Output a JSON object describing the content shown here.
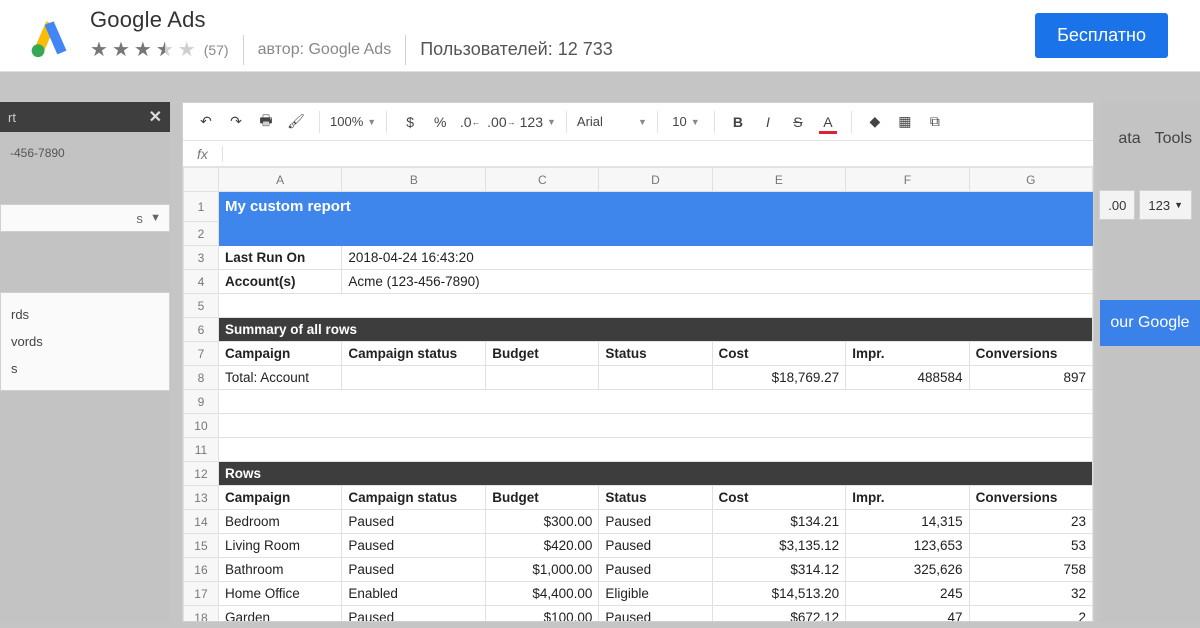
{
  "store": {
    "title": "Google Ads",
    "stars": 3.5,
    "rating_count": "(57)",
    "author_label": "автор: Google Ads",
    "users_label": "Пользователей: 12 733",
    "cta": "Бесплатно"
  },
  "bg_left": {
    "bar_text": "rt",
    "phone": "-456-7890",
    "options": [
      "rds",
      "vords",
      "s"
    ]
  },
  "bg_right": {
    "menu": [
      "ata",
      "Tools"
    ],
    "tb_items": [
      ".00",
      "123"
    ],
    "blue_button": "our Google"
  },
  "toolbar": {
    "zoom": "100%",
    "num_fmt_items": [
      "$",
      "%",
      ".0",
      ".00",
      "123"
    ],
    "font_family": "Arial",
    "font_size": "10"
  },
  "fx": {
    "label": "fx",
    "value": ""
  },
  "columns": [
    "A",
    "B",
    "C",
    "D",
    "E",
    "F",
    "G"
  ],
  "sheet": {
    "report_title": "My custom report",
    "meta": {
      "last_run_label": "Last Run On",
      "last_run_value": "2018-04-24 16:43:20",
      "accounts_label": "Account(s)",
      "accounts_value": "Acme (123-456-7890)"
    },
    "summary_section": "Summary of all rows",
    "rows_section": "Rows",
    "headers": [
      "Campaign",
      "Campaign status",
      "Budget",
      "Status",
      "Cost",
      "Impr.",
      "Conversions"
    ],
    "summary_row": {
      "campaign": "Total: Account",
      "status": "",
      "budget": "",
      "row_status": "",
      "cost": "$18,769.27",
      "impr": "488584",
      "conv": "897"
    },
    "data_rows": [
      {
        "campaign": "Bedroom",
        "cstatus": "Paused",
        "budget": "$300.00",
        "status": "Paused",
        "cost": "$134.21",
        "impr": "14,315",
        "conv": "23"
      },
      {
        "campaign": "Living Room",
        "cstatus": "Paused",
        "budget": "$420.00",
        "status": "Paused",
        "cost": "$3,135.12",
        "impr": "123,653",
        "conv": "53"
      },
      {
        "campaign": "Bathroom",
        "cstatus": "Paused",
        "budget": "$1,000.00",
        "status": "Paused",
        "cost": "$314.12",
        "impr": "325,626",
        "conv": "758"
      },
      {
        "campaign": "Home Office",
        "cstatus": "Enabled",
        "budget": "$4,400.00",
        "status": "Eligible",
        "cost": "$14,513.20",
        "impr": "245",
        "conv": "32"
      },
      {
        "campaign": "Garden",
        "cstatus": "Paused",
        "budget": "$100.00",
        "status": "Paused",
        "cost": "$672.12",
        "impr": "47",
        "conv": "2"
      }
    ]
  }
}
